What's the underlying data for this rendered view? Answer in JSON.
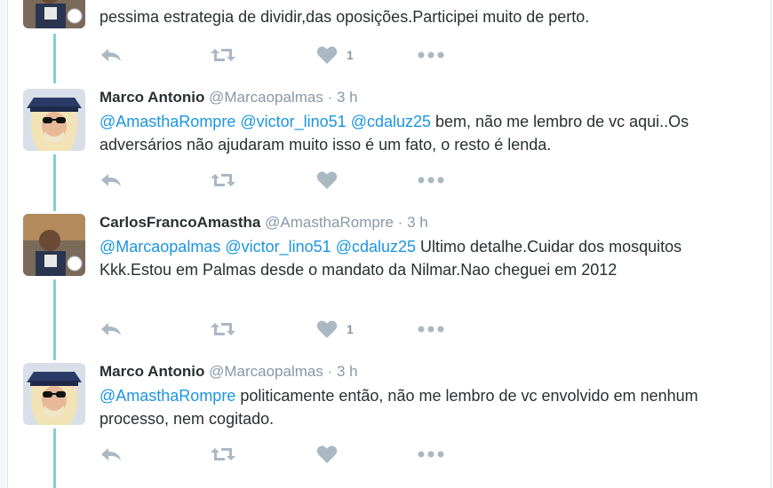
{
  "tweets": [
    {
      "text_parts": [
        {
          "text": "pessima estrategia de dividir,das oposições.Participei muito de perto."
        }
      ],
      "likes": "1"
    },
    {
      "name": "Marco Antonio",
      "handle": "@Marcaopalmas",
      "dot": "·",
      "time": "3 h",
      "text_parts": [
        {
          "text": "@AmasthaRompre",
          "mention": true
        },
        {
          "text": " "
        },
        {
          "text": "@victor_lino51",
          "mention": true
        },
        {
          "text": " "
        },
        {
          "text": "@cdaluz25",
          "mention": true
        },
        {
          "text": " bem, não me lembro de vc aqui..Os adversários não ajudaram muito isso é um fato, o resto é lenda."
        }
      ],
      "likes": ""
    },
    {
      "name": "CarlosFrancoAmastha",
      "handle": "@AmasthaRompre",
      "dot": "·",
      "time": "3 h",
      "text_parts": [
        {
          "text": "@Marcaopalmas",
          "mention": true
        },
        {
          "text": " "
        },
        {
          "text": "@victor_lino51",
          "mention": true
        },
        {
          "text": " "
        },
        {
          "text": "@cdaluz25",
          "mention": true
        },
        {
          "text": " Ultimo detalhe.Cuidar dos mosquitos Kkk.Estou em Palmas desde o mandato da Nilmar.Nao cheguei em 2012"
        }
      ],
      "likes": "1"
    },
    {
      "name": "Marco Antonio",
      "handle": "@Marcaopalmas",
      "dot": "·",
      "time": "3 h",
      "text_parts": [
        {
          "text": "@AmasthaRompre",
          "mention": true
        },
        {
          "text": " politicamente então, não me lembro de vc envolvido em nenhum processo, nem cogitado."
        }
      ],
      "likes": ""
    }
  ],
  "colors": {
    "mention": "#1b95e0",
    "meta": "#8899a6",
    "thread_line": "#7fd0dc",
    "action_icon": "#aab8c2"
  },
  "icons": {
    "reply": "reply-icon",
    "retweet": "retweet-icon",
    "like": "heart-icon",
    "more": "more-dots-icon"
  }
}
